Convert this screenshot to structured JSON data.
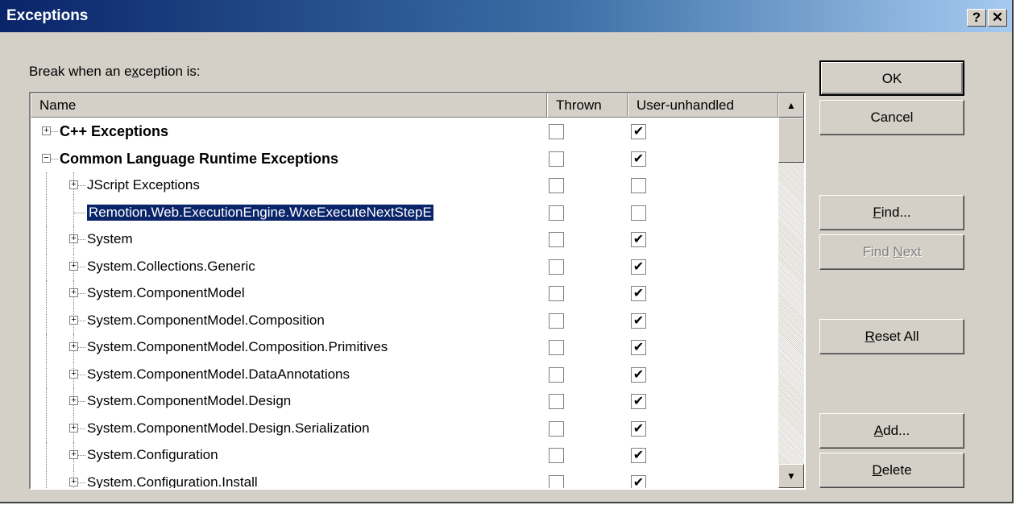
{
  "window": {
    "title": "Exceptions",
    "help_button": "?",
    "close_button": "✕"
  },
  "prompt": {
    "before": "Break when an e",
    "accel": "x",
    "after": "ception is:"
  },
  "columns": {
    "name": "Name",
    "thrown": "Thrown",
    "user_unhandled": "User-unhandled"
  },
  "rows": [
    {
      "label": "C++ Exceptions",
      "level": 0,
      "expander": "+",
      "bold": true,
      "thrown": false,
      "user_unhandled": true
    },
    {
      "label": "Common Language Runtime Exceptions",
      "level": 0,
      "expander": "−",
      "bold": true,
      "thrown": false,
      "user_unhandled": true
    },
    {
      "label": "JScript Exceptions",
      "level": 1,
      "expander": "+",
      "bold": false,
      "thrown": false,
      "user_unhandled": false
    },
    {
      "label": "Remotion.Web.ExecutionEngine.WxeExecuteNextStepE",
      "level": 1,
      "expander": "",
      "bold": false,
      "selected": true,
      "thrown": false,
      "user_unhandled": false
    },
    {
      "label": "System",
      "level": 1,
      "expander": "+",
      "bold": false,
      "thrown": false,
      "user_unhandled": true
    },
    {
      "label": "System.Collections.Generic",
      "level": 1,
      "expander": "+",
      "bold": false,
      "thrown": false,
      "user_unhandled": true
    },
    {
      "label": "System.ComponentModel",
      "level": 1,
      "expander": "+",
      "bold": false,
      "thrown": false,
      "user_unhandled": true
    },
    {
      "label": "System.ComponentModel.Composition",
      "level": 1,
      "expander": "+",
      "bold": false,
      "thrown": false,
      "user_unhandled": true
    },
    {
      "label": "System.ComponentModel.Composition.Primitives",
      "level": 1,
      "expander": "+",
      "bold": false,
      "thrown": false,
      "user_unhandled": true
    },
    {
      "label": "System.ComponentModel.DataAnnotations",
      "level": 1,
      "expander": "+",
      "bold": false,
      "thrown": false,
      "user_unhandled": true
    },
    {
      "label": "System.ComponentModel.Design",
      "level": 1,
      "expander": "+",
      "bold": false,
      "thrown": false,
      "user_unhandled": true
    },
    {
      "label": "System.ComponentModel.Design.Serialization",
      "level": 1,
      "expander": "+",
      "bold": false,
      "thrown": false,
      "user_unhandled": true
    },
    {
      "label": "System.Configuration",
      "level": 1,
      "expander": "+",
      "bold": false,
      "thrown": false,
      "user_unhandled": true
    },
    {
      "label": "System.Configuration.Install",
      "level": 1,
      "expander": "+",
      "bold": false,
      "thrown": false,
      "user_unhandled": true
    }
  ],
  "scrollbar": {
    "up_arrow": "▲",
    "down_arrow": "▼"
  },
  "buttons": {
    "ok": "OK",
    "cancel": "Cancel",
    "find": {
      "accel": "F",
      "rest": "ind..."
    },
    "find_next": {
      "before": "Find ",
      "accel": "N",
      "rest": "ext"
    },
    "reset_all": {
      "accel": "R",
      "rest": "eset All"
    },
    "add": {
      "accel": "A",
      "rest": "dd..."
    },
    "delete": {
      "accel": "D",
      "rest": "elete"
    }
  },
  "check_glyph": "✔",
  "colors": {
    "title_start": "#0a246a",
    "title_end": "#a6caf0",
    "selection": "#0a246a",
    "face": "#d4d0c8"
  }
}
